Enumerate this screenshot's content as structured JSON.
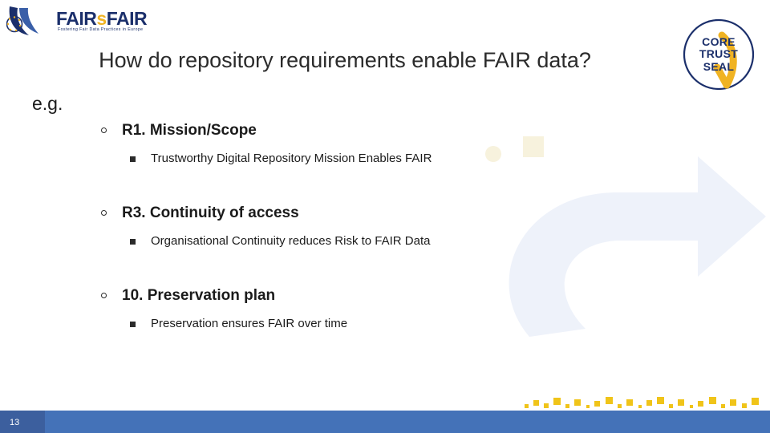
{
  "logo": {
    "name": "fairsfair-logo",
    "text_fair": "FAIR",
    "text_s": "s",
    "text_fair2": "FAIR",
    "tagline": "Fostering Fair Data Practices in Europe"
  },
  "badge": {
    "name": "coretrustseal-badge",
    "line1": "CORE",
    "line2": "TRUST",
    "line3": "SEAL",
    "check_color": "#f0b323",
    "text_color": "#1b2f6b"
  },
  "slide": {
    "title": "How do repository requirements enable FAIR data?",
    "intro": "e.g.",
    "groups": [
      {
        "heading": "R1. Mission/Scope",
        "detail": "Trustworthy Digital Repository Mission Enables FAIR"
      },
      {
        "heading": "R3. Continuity of access",
        "detail": "Organisational Continuity reduces Risk to FAIR Data"
      },
      {
        "heading": "10. Preservation plan",
        "detail": "Preservation ensures FAIR over time"
      }
    ]
  },
  "footer": {
    "page_number": "13",
    "bar_color": "#4472b8",
    "number_box_color": "#3c5f9e",
    "dot_color": "#f0c419"
  }
}
